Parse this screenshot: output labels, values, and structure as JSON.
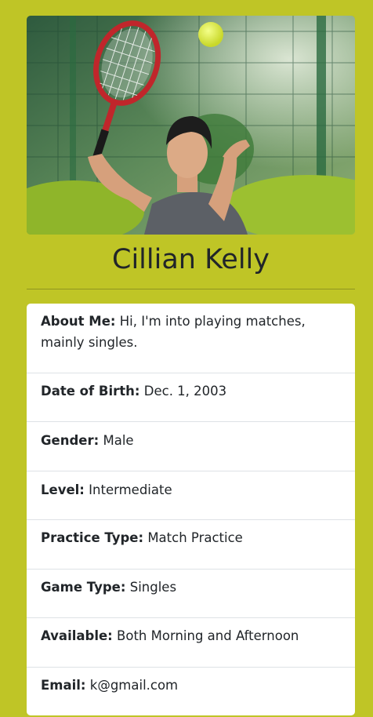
{
  "profile": {
    "name": "Cillian Kelly"
  },
  "details": [
    {
      "label": "About Me:",
      "value": "Hi, I'm into playing matches, mainly singles."
    },
    {
      "label": "Date of Birth:",
      "value": "Dec. 1, 2003"
    },
    {
      "label": "Gender:",
      "value": "Male"
    },
    {
      "label": "Level:",
      "value": "Intermediate"
    },
    {
      "label": "Practice Type:",
      "value": "Match Practice"
    },
    {
      "label": "Game Type:",
      "value": "Singles"
    },
    {
      "label": "Available:",
      "value": "Both Morning and Afternoon"
    },
    {
      "label": "Email:",
      "value": "k@gmail.com"
    }
  ],
  "colors": {
    "page_background": "#bfc526",
    "card_background": "#ffffff",
    "text": "#212529"
  }
}
